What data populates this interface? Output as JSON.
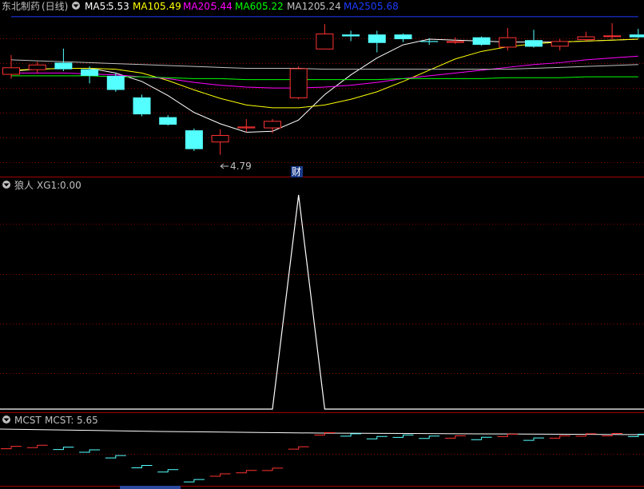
{
  "stock": {
    "name": "东北制药",
    "period": "(日线)"
  },
  "ma_legend": [
    {
      "label": "MA5:",
      "value": "5.53",
      "color": "#ffffff"
    },
    {
      "label": "MA10:",
      "value": "5.49",
      "color": "#ffff00"
    },
    {
      "label": "MA20:",
      "value": "5.44",
      "color": "#ff00ff"
    },
    {
      "label": "MA60:",
      "value": "5.22",
      "color": "#00ff00"
    },
    {
      "label": "MA120:",
      "value": "5.24",
      "color": "#c0c0c0"
    },
    {
      "label": "MA250:",
      "value": "5.68",
      "color": "#0000ff"
    }
  ],
  "low_marker": "4.79",
  "fin_marker": "财",
  "indicator": {
    "name": "狼人",
    "series": "XG1:",
    "value": "0.00"
  },
  "mcst": {
    "name": "MCST",
    "series": "MCST:",
    "value": "5.65"
  },
  "colors": {
    "up": "#ff3232",
    "down": "#54ffff",
    "grid": "#8b0000",
    "divider": "#a00000",
    "text": "#c0c0c0",
    "xg1": "#ffffff"
  },
  "chart_data": [
    {
      "type": "candlestick",
      "title": "东北制药(日线)",
      "ylim": [
        4.6,
        6.25
      ],
      "grid": true,
      "candles": [
        {
          "open": 5.65,
          "close": 5.72,
          "high": 5.85,
          "low": 5.6
        },
        {
          "open": 5.7,
          "close": 5.75,
          "high": 5.78,
          "low": 5.66
        },
        {
          "open": 5.77,
          "close": 5.7,
          "high": 5.92,
          "low": 5.68
        },
        {
          "open": 5.7,
          "close": 5.63,
          "high": 5.73,
          "low": 5.55
        },
        {
          "open": 5.63,
          "close": 5.48,
          "high": 5.66,
          "low": 5.46
        },
        {
          "open": 5.4,
          "close": 5.22,
          "high": 5.43,
          "low": 5.2
        },
        {
          "open": 5.19,
          "close": 5.11,
          "high": 5.21,
          "low": 5.1
        },
        {
          "open": 5.05,
          "close": 4.85,
          "high": 5.07,
          "low": 4.83
        },
        {
          "open": 4.93,
          "close": 5.0,
          "high": 5.06,
          "low": 4.79
        },
        {
          "open": 5.08,
          "close": 5.09,
          "high": 5.17,
          "low": 5.03
        },
        {
          "open": 5.08,
          "close": 5.15,
          "high": 5.17,
          "low": 5.02
        },
        {
          "open": 5.4,
          "close": 5.71,
          "high": 5.73,
          "low": 5.38
        },
        {
          "open": 5.92,
          "close": 6.08,
          "high": 6.18,
          "low": 5.92
        },
        {
          "open": 6.07,
          "close": 6.05,
          "high": 6.11,
          "low": 6.0
        },
        {
          "open": 6.07,
          "close": 5.98,
          "high": 6.11,
          "low": 5.88
        },
        {
          "open": 6.07,
          "close": 6.02,
          "high": 6.08,
          "low": 5.99
        },
        {
          "open": 6.0,
          "close": 5.99,
          "high": 6.03,
          "low": 5.96
        },
        {
          "open": 5.99,
          "close": 6.0,
          "high": 6.04,
          "low": 5.97
        },
        {
          "open": 6.04,
          "close": 5.96,
          "high": 6.05,
          "low": 5.95
        },
        {
          "open": 5.94,
          "close": 6.04,
          "high": 6.14,
          "low": 5.9
        },
        {
          "open": 6.01,
          "close": 5.94,
          "high": 6.12,
          "low": 5.93
        },
        {
          "open": 5.95,
          "close": 6.0,
          "high": 6.02,
          "low": 5.9
        },
        {
          "open": 6.02,
          "close": 6.05,
          "high": 6.1,
          "low": 6.0
        },
        {
          "open": 6.06,
          "close": 6.06,
          "high": 6.19,
          "low": 6.02
        },
        {
          "open": 6.07,
          "close": 6.04,
          "high": 6.13,
          "low": 6.03
        }
      ],
      "series": [
        {
          "name": "MA5",
          "values": [
            5.68,
            5.7,
            5.71,
            5.71,
            5.66,
            5.57,
            5.42,
            5.24,
            5.12,
            5.03,
            5.04,
            5.16,
            5.43,
            5.64,
            5.82,
            5.96,
            6.02,
            6.01,
            6.0,
            5.99,
            5.99,
            5.99,
            6.0,
            6.01,
            6.02
          ]
        },
        {
          "name": "MA10",
          "values": [
            5.69,
            5.7,
            5.71,
            5.71,
            5.7,
            5.66,
            5.58,
            5.48,
            5.39,
            5.32,
            5.29,
            5.29,
            5.32,
            5.38,
            5.46,
            5.57,
            5.69,
            5.81,
            5.89,
            5.94,
            5.97,
            5.99,
            6.0,
            6.01,
            6.02
          ]
        },
        {
          "name": "MA20",
          "values": [
            5.66,
            5.66,
            5.66,
            5.65,
            5.64,
            5.62,
            5.6,
            5.56,
            5.53,
            5.51,
            5.5,
            5.5,
            5.51,
            5.53,
            5.56,
            5.6,
            5.63,
            5.66,
            5.69,
            5.72,
            5.75,
            5.77,
            5.8,
            5.82,
            5.84
          ]
        },
        {
          "name": "MA60",
          "values": [
            5.63,
            5.63,
            5.63,
            5.63,
            5.62,
            5.62,
            5.61,
            5.6,
            5.6,
            5.59,
            5.59,
            5.59,
            5.59,
            5.59,
            5.59,
            5.6,
            5.6,
            5.6,
            5.6,
            5.61,
            5.61,
            5.61,
            5.62,
            5.62,
            5.62
          ]
        },
        {
          "name": "MA120",
          "values": [
            5.8,
            5.79,
            5.78,
            5.77,
            5.76,
            5.75,
            5.74,
            5.73,
            5.72,
            5.71,
            5.71,
            5.71,
            5.7,
            5.7,
            5.7,
            5.7,
            5.7,
            5.7,
            5.7,
            5.7,
            5.71,
            5.72,
            5.73,
            5.74,
            5.75
          ]
        },
        {
          "name": "MA250",
          "values": [
            6.26,
            6.26,
            6.26,
            6.26,
            6.26,
            6.26,
            6.26,
            6.26,
            6.26,
            6.26,
            6.26,
            6.26,
            6.26,
            6.26,
            6.26,
            6.26,
            6.26,
            6.26,
            6.26,
            6.26,
            6.26,
            6.26,
            6.26,
            6.26,
            6.26
          ]
        }
      ]
    },
    {
      "type": "line",
      "title": "狼人 XG1",
      "ylim": [
        0,
        1
      ],
      "series": [
        {
          "name": "XG1",
          "values": [
            0,
            0,
            0,
            0,
            0,
            0,
            0,
            0,
            0,
            0,
            0,
            1,
            0,
            0,
            0,
            0,
            0,
            0,
            0,
            0,
            0,
            0,
            0,
            0,
            0
          ]
        }
      ]
    },
    {
      "type": "line",
      "title": "MCST",
      "series": [
        {
          "name": "MCST",
          "values": [
            5.73,
            5.73,
            5.74,
            5.72,
            5.68,
            5.62,
            5.58,
            5.56,
            5.55,
            5.58,
            5.6,
            5.67,
            5.74,
            5.75,
            5.75,
            5.74,
            5.74,
            5.73,
            5.73,
            5.74,
            5.74,
            5.75,
            5.75,
            5.76,
            5.75
          ]
        }
      ]
    }
  ]
}
